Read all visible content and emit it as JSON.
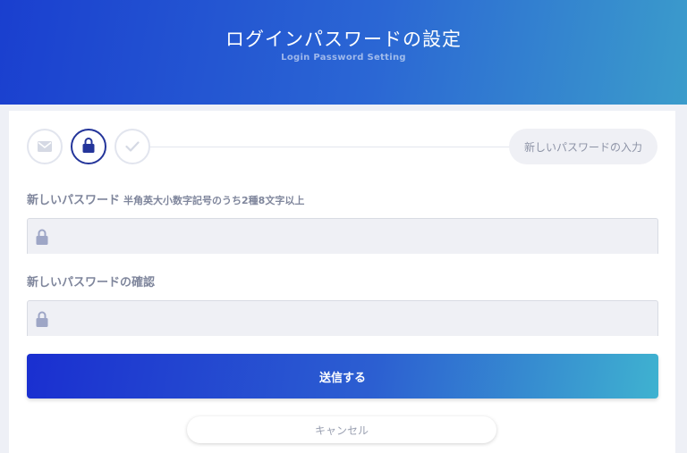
{
  "header": {
    "title": "ログインパスワードの設定",
    "subtitle": "Login Password Setting"
  },
  "stepper": {
    "steps": [
      {
        "icon": "mail-icon",
        "state": "done"
      },
      {
        "icon": "lock-icon",
        "state": "active"
      },
      {
        "icon": "check-icon",
        "state": "pending"
      }
    ],
    "current_label": "新しいパスワードの入力"
  },
  "form": {
    "new_password": {
      "label": "新しいパスワード",
      "hint": "半角英大小数字記号のうち2種8文字以上",
      "value": "",
      "icon": "lock-icon"
    },
    "confirm_password": {
      "label": "新しいパスワードの確認",
      "value": "",
      "icon": "lock-icon"
    },
    "submit_label": "送信する",
    "cancel_label": "キャンセル"
  },
  "colors": {
    "primary": "#1a3fcf",
    "accent": "#3fb2d0",
    "active_step": "#24359a",
    "icon_gray": "#9ea6c6"
  }
}
